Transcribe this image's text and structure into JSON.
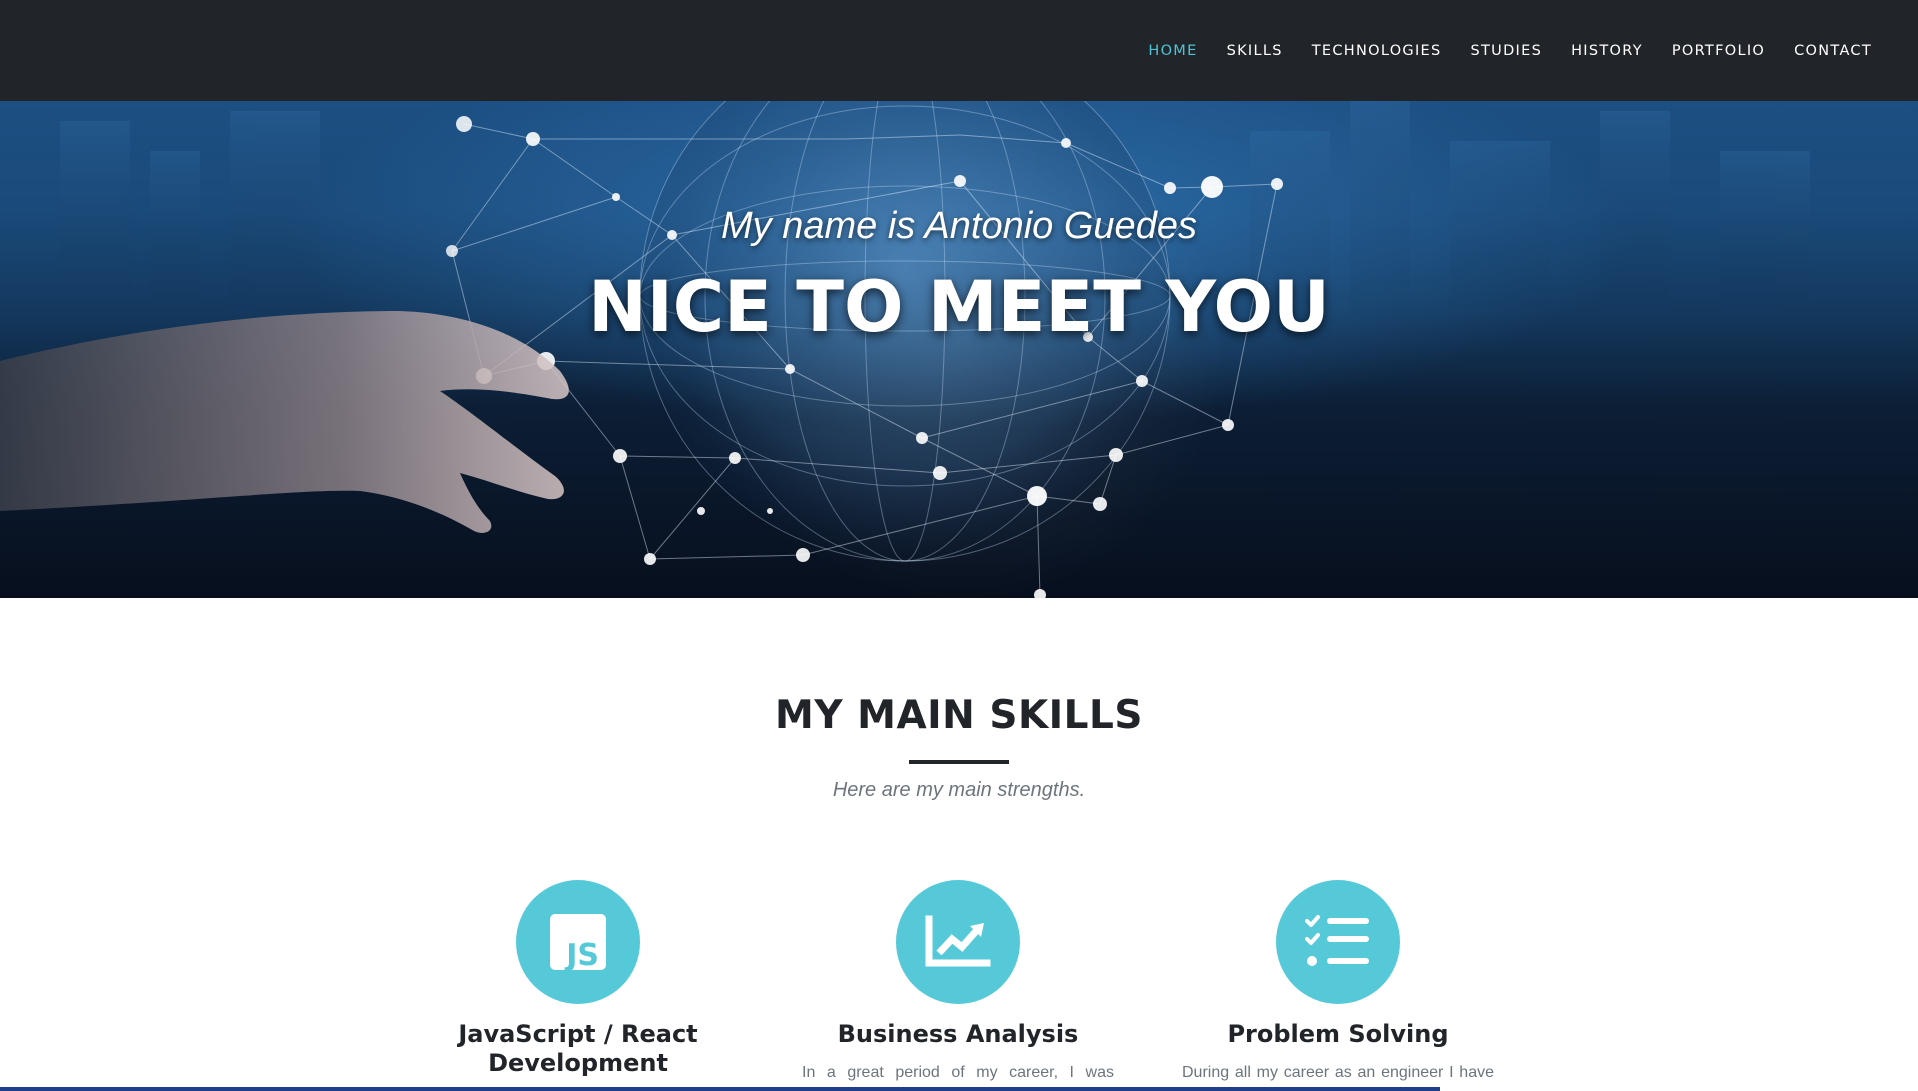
{
  "nav": {
    "items": [
      {
        "label": "HOME",
        "active": true
      },
      {
        "label": "SKILLS",
        "active": false
      },
      {
        "label": "TECHNOLOGIES",
        "active": false
      },
      {
        "label": "STUDIES",
        "active": false
      },
      {
        "label": "HISTORY",
        "active": false
      },
      {
        "label": "PORTFOLIO",
        "active": false
      },
      {
        "label": "CONTACT",
        "active": false
      }
    ],
    "active_color": "#4fc3d7",
    "background": "#212529"
  },
  "hero": {
    "subtitle": "My name is Antonio Guedes",
    "title": "NICE TO MEET YOU"
  },
  "skills": {
    "heading": "MY MAIN SKILLS",
    "subheading": "Here are my main strengths.",
    "accent_color": "#56c9d9",
    "items": [
      {
        "icon": "javascript-icon",
        "icon_text": "JS",
        "title": "JavaScript / React Development",
        "text": ""
      },
      {
        "icon": "chart-line-icon",
        "title": "Business Analysis",
        "text": "In a great period of my career, I was"
      },
      {
        "icon": "tasks-list-icon",
        "title": "Problem Solving",
        "text": "During all my career as an engineer I have"
      }
    ]
  }
}
